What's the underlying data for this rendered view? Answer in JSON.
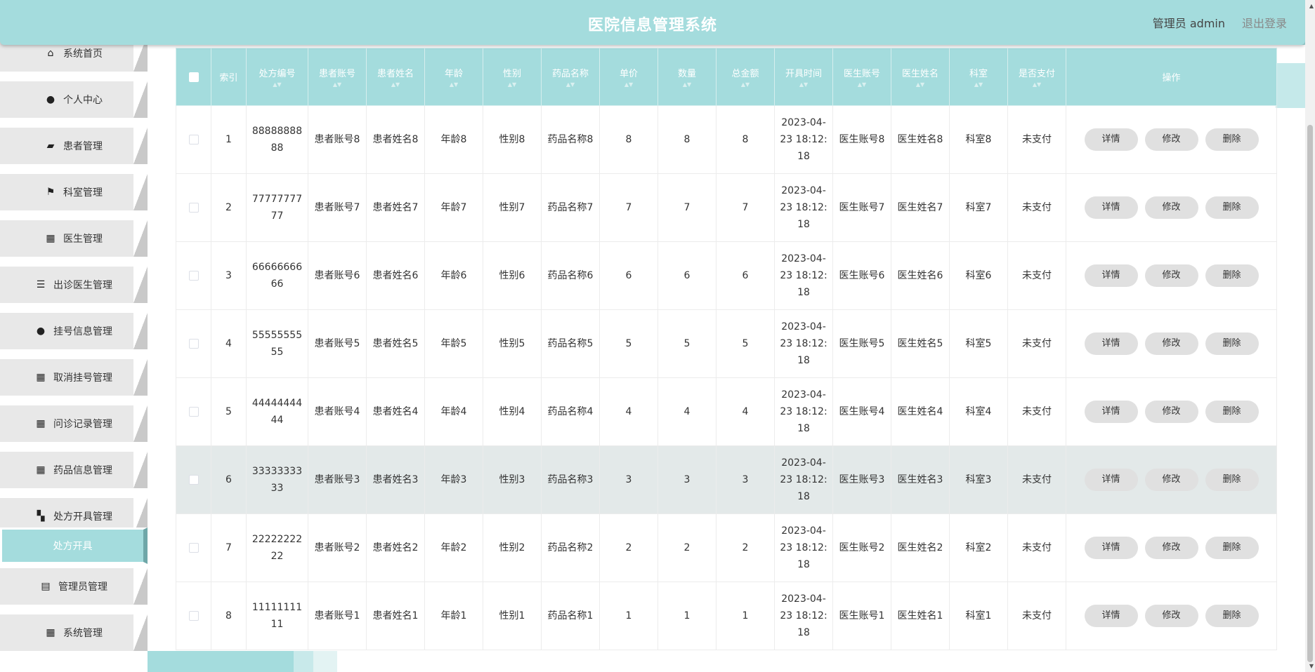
{
  "header": {
    "title": "医院信息管理系统",
    "user": "管理员 admin",
    "logout": "退出登录"
  },
  "sidebar": {
    "items": [
      {
        "label": "系统首页",
        "icon": "home-icon",
        "glyph": "⌂"
      },
      {
        "label": "个人中心",
        "icon": "person-icon",
        "glyph": "●"
      },
      {
        "label": "患者管理",
        "icon": "wallet-icon",
        "glyph": "▰"
      },
      {
        "label": "科室管理",
        "icon": "flag-icon",
        "glyph": "⚑"
      },
      {
        "label": "医生管理",
        "icon": "grid-icon",
        "glyph": "▦"
      },
      {
        "label": "出诊医生管理",
        "icon": "sliders-icon",
        "glyph": "☰"
      },
      {
        "label": "挂号信息管理",
        "icon": "user-icon",
        "glyph": "●"
      },
      {
        "label": "取消挂号管理",
        "icon": "grid-icon",
        "glyph": "▦"
      },
      {
        "label": "问诊记录管理",
        "icon": "grid-icon",
        "glyph": "▦"
      },
      {
        "label": "药品信息管理",
        "icon": "grid-icon",
        "glyph": "▦"
      },
      {
        "label": "处方开具管理",
        "icon": "ticket-icon",
        "glyph": "▚"
      },
      {
        "label": "处方开具",
        "icon": "",
        "glyph": "",
        "sub": true
      },
      {
        "label": "管理员管理",
        "icon": "printer-icon",
        "glyph": "▤"
      },
      {
        "label": "系统管理",
        "icon": "grid-icon",
        "glyph": "▦"
      }
    ]
  },
  "table": {
    "columns": [
      "索引",
      "处方编号",
      "患者账号",
      "患者姓名",
      "年龄",
      "性别",
      "药品名称",
      "单价",
      "数量",
      "总金额",
      "开具时间",
      "医生账号",
      "医生姓名",
      "科室",
      "是否支付",
      "操作"
    ],
    "actions": [
      "详情",
      "修改",
      "删除"
    ],
    "rows": [
      [
        "1",
        "8888888888",
        "患者账号8",
        "患者姓名8",
        "年龄8",
        "性别8",
        "药品名称8",
        "8",
        "8",
        "8",
        "2023-04-23 18:12:18",
        "医生账号8",
        "医生姓名8",
        "科室8",
        "未支付"
      ],
      [
        "2",
        "7777777777",
        "患者账号7",
        "患者姓名7",
        "年龄7",
        "性别7",
        "药品名称7",
        "7",
        "7",
        "7",
        "2023-04-23 18:12:18",
        "医生账号7",
        "医生姓名7",
        "科室7",
        "未支付"
      ],
      [
        "3",
        "6666666666",
        "患者账号6",
        "患者姓名6",
        "年龄6",
        "性别6",
        "药品名称6",
        "6",
        "6",
        "6",
        "2023-04-23 18:12:18",
        "医生账号6",
        "医生姓名6",
        "科室6",
        "未支付"
      ],
      [
        "4",
        "5555555555",
        "患者账号5",
        "患者姓名5",
        "年龄5",
        "性别5",
        "药品名称5",
        "5",
        "5",
        "5",
        "2023-04-23 18:12:18",
        "医生账号5",
        "医生姓名5",
        "科室5",
        "未支付"
      ],
      [
        "5",
        "4444444444",
        "患者账号4",
        "患者姓名4",
        "年龄4",
        "性别4",
        "药品名称4",
        "4",
        "4",
        "4",
        "2023-04-23 18:12:18",
        "医生账号4",
        "医生姓名4",
        "科室4",
        "未支付"
      ],
      [
        "6",
        "3333333333",
        "患者账号3",
        "患者姓名3",
        "年龄3",
        "性别3",
        "药品名称3",
        "3",
        "3",
        "3",
        "2023-04-23 18:12:18",
        "医生账号3",
        "医生姓名3",
        "科室3",
        "未支付"
      ],
      [
        "7",
        "2222222222",
        "患者账号2",
        "患者姓名2",
        "年龄2",
        "性别2",
        "药品名称2",
        "2",
        "2",
        "2",
        "2023-04-23 18:12:18",
        "医生账号2",
        "医生姓名2",
        "科室2",
        "未支付"
      ],
      [
        "8",
        "1111111111",
        "患者账号1",
        "患者姓名1",
        "年龄1",
        "性别1",
        "药品名称1",
        "1",
        "1",
        "1",
        "2023-04-23 18:12:18",
        "医生账号1",
        "医生姓名1",
        "科室1",
        "未支付"
      ]
    ],
    "highlighted_row": 6
  },
  "colors": {
    "accent": "#a4dcdd",
    "highlight_row": "#e3e9e9",
    "button_bg": "#e0e0e0"
  }
}
